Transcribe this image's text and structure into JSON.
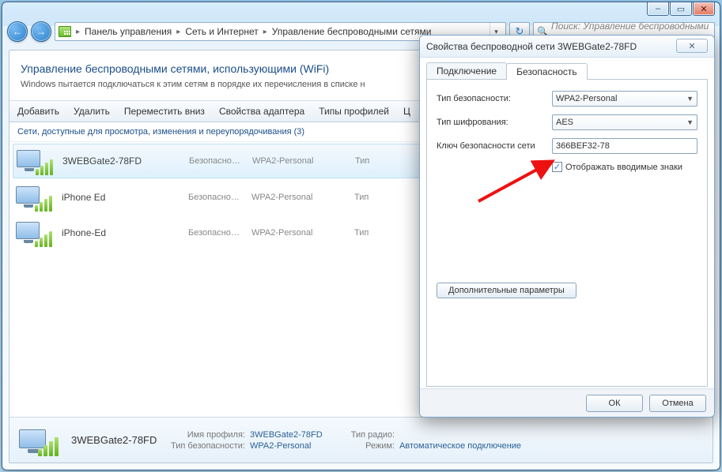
{
  "caption": {
    "minimize_icon": "–",
    "maximize_icon": "▭",
    "close_icon": "✕"
  },
  "nav": {
    "back_icon": "←",
    "forward_icon": "→",
    "refresh_icon": "↻",
    "crumbs": [
      "Панель управления",
      "Сеть и Интернет",
      "Управление беспроводными сетями"
    ],
    "search_placeholder": "Поиск: Управление беспроводными ..."
  },
  "page": {
    "title": "Управление беспроводными сетями, использующими (WiFi)",
    "subtitle": "Windows пытается подключаться к этим сетям в порядке их перечисления в списке н"
  },
  "toolbar": {
    "items": [
      "Добавить",
      "Удалить",
      "Переместить вниз",
      "Свойства адаптера",
      "Типы профилей",
      "Ц"
    ]
  },
  "section_header": "Сети, доступные для просмотра, изменения и переупорядочивания (3)",
  "networks": [
    {
      "name": "3WEBGate2-78FD",
      "security": "Безопасно…",
      "auth": "WPA2-Personal",
      "type": "Тип",
      "selected": true
    },
    {
      "name": "iPhone Ed",
      "security": "Безопасно…",
      "auth": "WPA2-Personal",
      "type": "Тип",
      "selected": false
    },
    {
      "name": "iPhone-Ed",
      "security": "Безопасно…",
      "auth": "WPA2-Personal",
      "type": "Тип",
      "selected": false
    }
  ],
  "details": {
    "name": "3WEBGate2-78FD",
    "profile_label": "Имя профиля:",
    "profile_value": "3WEBGate2-78FD",
    "radio_label": "Тип радио:",
    "radio_value": "",
    "security_label": "Тип безопасности:",
    "security_value": "WPA2-Personal",
    "mode_label": "Режим:",
    "mode_value": "Автоматическое подключение"
  },
  "dialog": {
    "title": "Свойства беспроводной сети 3WEBGate2-78FD",
    "close_icon": "✕",
    "tabs": {
      "connection": "Подключение",
      "security": "Безопасность"
    },
    "security_type_label": "Тип безопасности:",
    "security_type_value": "WPA2-Personal",
    "encryption_label": "Тип шифрования:",
    "encryption_value": "AES",
    "key_label": "Ключ безопасности сети",
    "key_value": "366BEF32-78",
    "show_chars_label": "Отображать вводимые знаки",
    "show_chars_checked": true,
    "advanced_button": "Дополнительные параметры",
    "ok_button": "ОК",
    "cancel_button": "Отмена"
  }
}
